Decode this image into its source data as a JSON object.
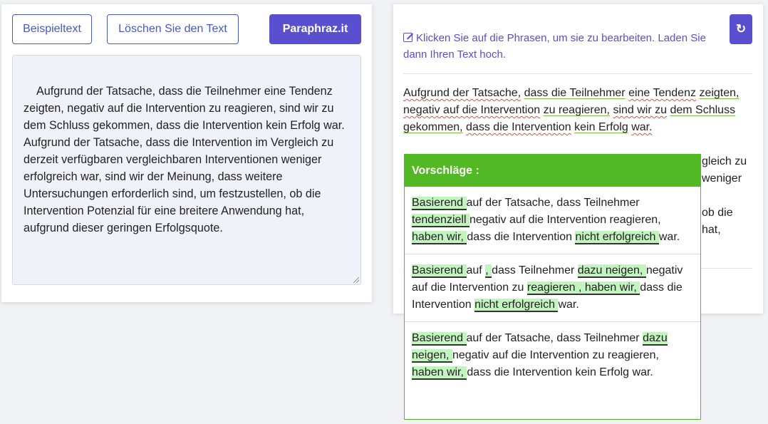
{
  "toolbar": {
    "sample_label": "Beispieltext",
    "clear_label": "Löschen Sie den Text",
    "paraphrase_label": "Paraphraz.it"
  },
  "input": {
    "text": "Aufgrund der Tatsache, dass die Teilnehmer eine Tendenz zeigten, negativ auf die Intervention zu reagieren, sind wir zu dem Schluss gekommen, dass die Intervention kein Erfolg war.\nAufgrund der Tatsache, dass die Intervention im Vergleich zu derzeit verfügbaren vergleichbaren Interventionen weniger erfolgreich war, sind wir der Meinung, dass weitere Untersuchungen erforderlich sind, um festzustellen, ob die Intervention Potenzial für eine breitere Anwendung hat, aufgrund dieser geringen Erfolgsquote."
  },
  "output": {
    "hint": "Klicken Sie auf die Phrasen, um sie zu bearbeiten. Laden Sie dann Ihren Text hoch.",
    "refresh_icon": "↻",
    "phrases": [
      "Aufgrund der Tatsache,",
      " ",
      "dass die Teilnehmer",
      " ",
      "eine Tendenz",
      " ",
      "zeigten,",
      " ",
      "negativ auf die Intervention",
      " ",
      "zu reagieren,",
      " ",
      "sind wir zu",
      " ",
      "dem Schluss gekommen,",
      " ",
      "dass die Intervention",
      " ",
      "kein Erfolg",
      " ",
      "war."
    ],
    "partial_right": [
      "gleich zu",
      "weniger",
      "ob die",
      "hat,"
    ]
  },
  "popup": {
    "title": "Vorschläge :",
    "suggestions": [
      {
        "parts": [
          {
            "t": "Basierend ",
            "h": true
          },
          {
            "t": "auf der Tatsache, dass Teilnehmer ",
            "h": false
          },
          {
            "t": "tendenziell ",
            "h": true
          },
          {
            "t": "negativ auf die Intervention reagieren, ",
            "h": false
          },
          {
            "t": "haben wir, ",
            "h": true
          },
          {
            "t": "dass die Intervention ",
            "h": false
          },
          {
            "t": "nicht erfolgreich ",
            "h": true
          },
          {
            "t": "war.",
            "h": false
          }
        ]
      },
      {
        "parts": [
          {
            "t": "Basierend ",
            "h": true
          },
          {
            "t": "auf ",
            "h": false
          },
          {
            "t": ", ",
            "h": true
          },
          {
            "t": "dass Teilnehmer ",
            "h": false
          },
          {
            "t": "dazu neigen, ",
            "h": true
          },
          {
            "t": "negativ auf die Intervention zu ",
            "h": false
          },
          {
            "t": "reagieren , haben wir, ",
            "h": true
          },
          {
            "t": "dass die Intervention ",
            "h": false
          },
          {
            "t": "nicht erfolgreich ",
            "h": true
          },
          {
            "t": "war.",
            "h": false
          }
        ]
      },
      {
        "parts": [
          {
            "t": "Basierend ",
            "h": true
          },
          {
            "t": "auf der Tatsache, dass Teilnehmer ",
            "h": false
          },
          {
            "t": "dazu neigen, ",
            "h": true
          },
          {
            "t": "negativ auf die Intervention zu reagieren, ",
            "h": false
          },
          {
            "t": "haben wir, ",
            "h": true
          },
          {
            "t": "dass die Intervention kein Erfolg war.",
            "h": false
          }
        ]
      }
    ]
  },
  "colors": {
    "accent": "#5a4fcf",
    "popup_green": "#52b823",
    "highlight_green": "#c3f3bf"
  }
}
